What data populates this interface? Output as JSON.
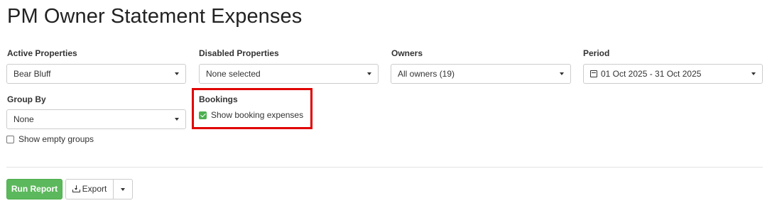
{
  "page": {
    "title": "PM Owner Statement Expenses"
  },
  "filters": {
    "active_properties": {
      "label": "Active Properties",
      "value": "Bear Bluff"
    },
    "disabled_properties": {
      "label": "Disabled Properties",
      "value": "None selected"
    },
    "owners": {
      "label": "Owners",
      "value": "All owners (19)"
    },
    "period": {
      "label": "Period",
      "value": "01 Oct 2025 - 31 Oct 2025",
      "icon": "calendar-icon"
    },
    "group_by": {
      "label": "Group By",
      "value": "None"
    },
    "show_empty_groups": {
      "label": "Show empty groups",
      "checked": false
    },
    "bookings": {
      "label": "Bookings",
      "show_booking_expenses": {
        "label": "Show booking expenses",
        "checked": true
      }
    }
  },
  "highlight": {
    "color": "#e00000"
  },
  "actions": {
    "run_report": "Run Report",
    "export": "Export",
    "export_icon": "download-icon",
    "run_color": "#5cb85c"
  }
}
